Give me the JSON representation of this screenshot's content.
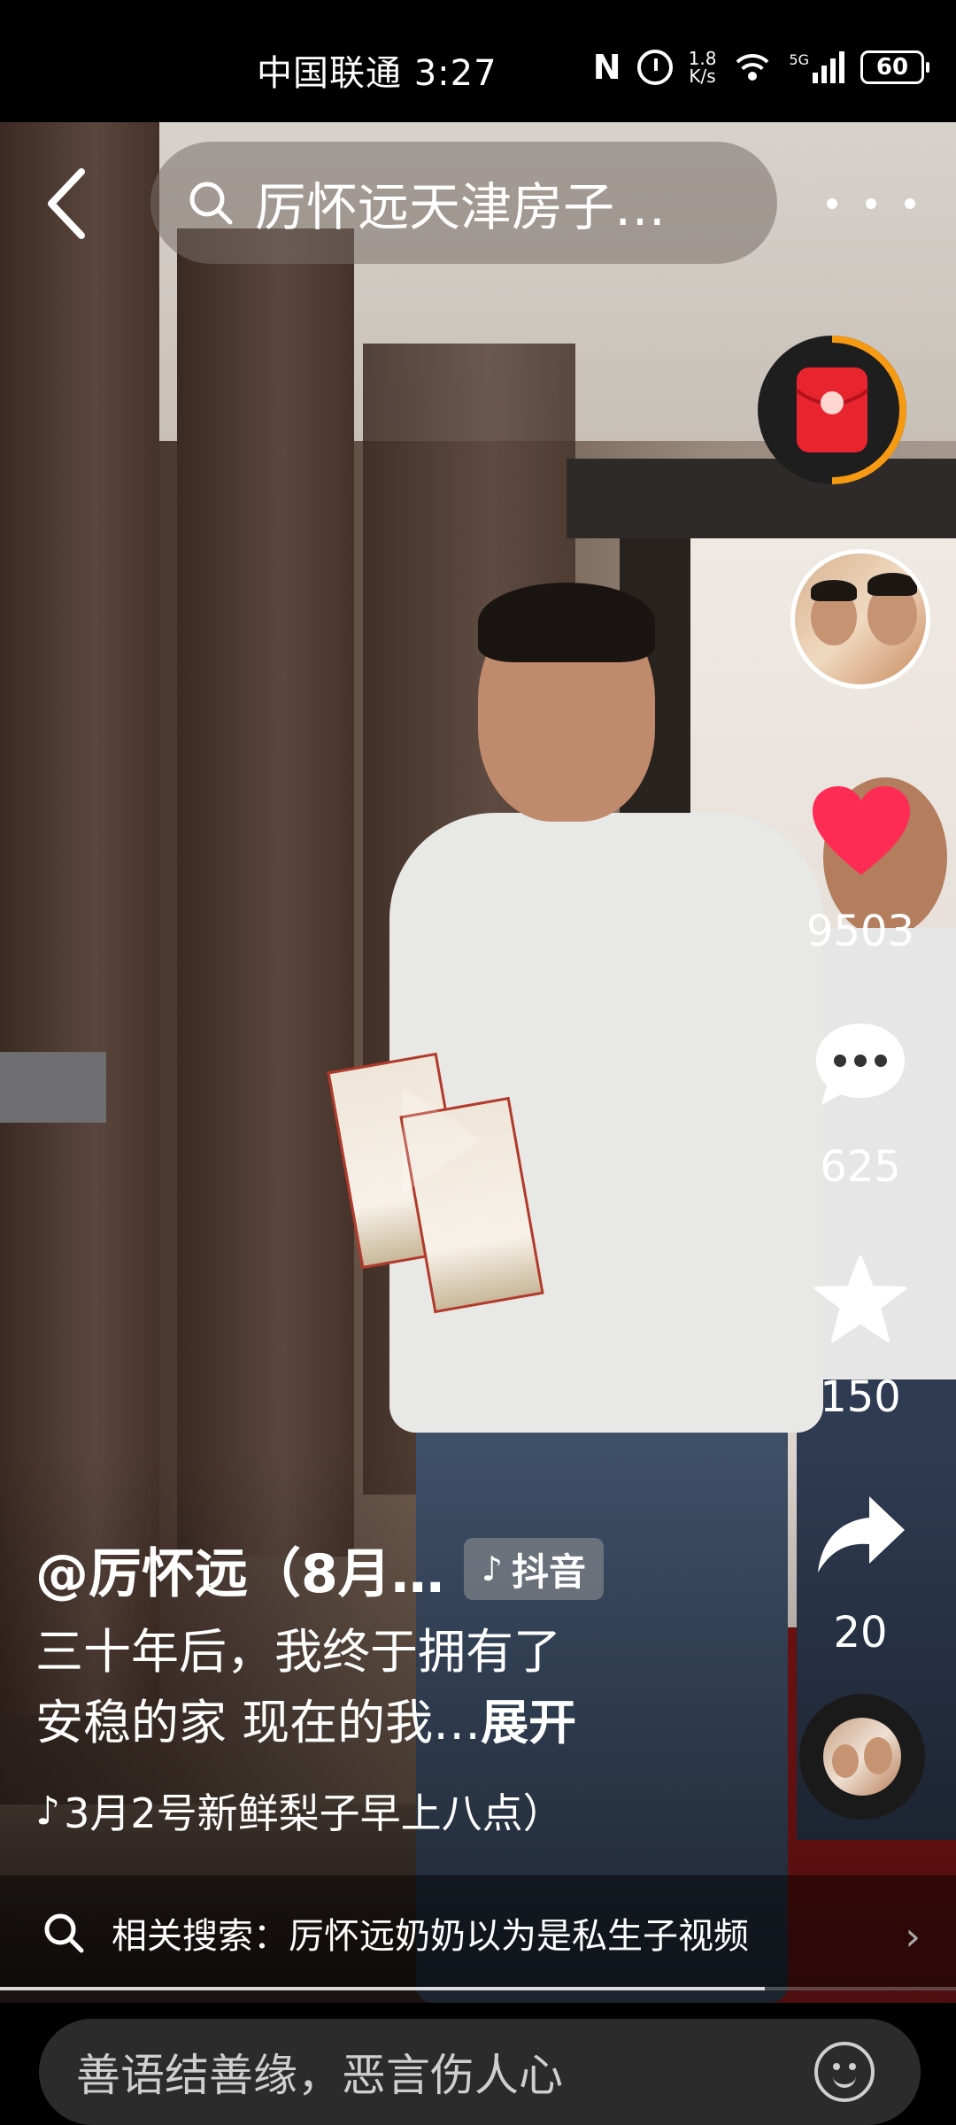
{
  "status_bar": {
    "carrier_time": "中国联通 3:27",
    "network_speed_value": "1.8",
    "network_speed_unit": "K/s",
    "network_type": "5G",
    "battery": "60"
  },
  "top_bar": {
    "search_text": "厉怀远天津房子…"
  },
  "right_rail": {
    "like_count": "9503",
    "comment_count": "625",
    "favorite_count": "150",
    "share_count": "20",
    "like_color": "#fe2c55"
  },
  "caption": {
    "author": "@厉怀远（8月…",
    "platform_badge": "抖音",
    "description_line1": "三十年后，我终于拥有了",
    "description_line2": "安稳的家 现在的我…",
    "expand_label": "展开",
    "music": "3月2号新鲜梨子早上八点）"
  },
  "related_search": {
    "label": "相关搜索：",
    "term": "厉怀远奶奶以为是私生子视频"
  },
  "playback": {
    "progress_fraction": 0.8
  },
  "comment_box": {
    "placeholder": "善语结善缘，恶言伤人心"
  }
}
